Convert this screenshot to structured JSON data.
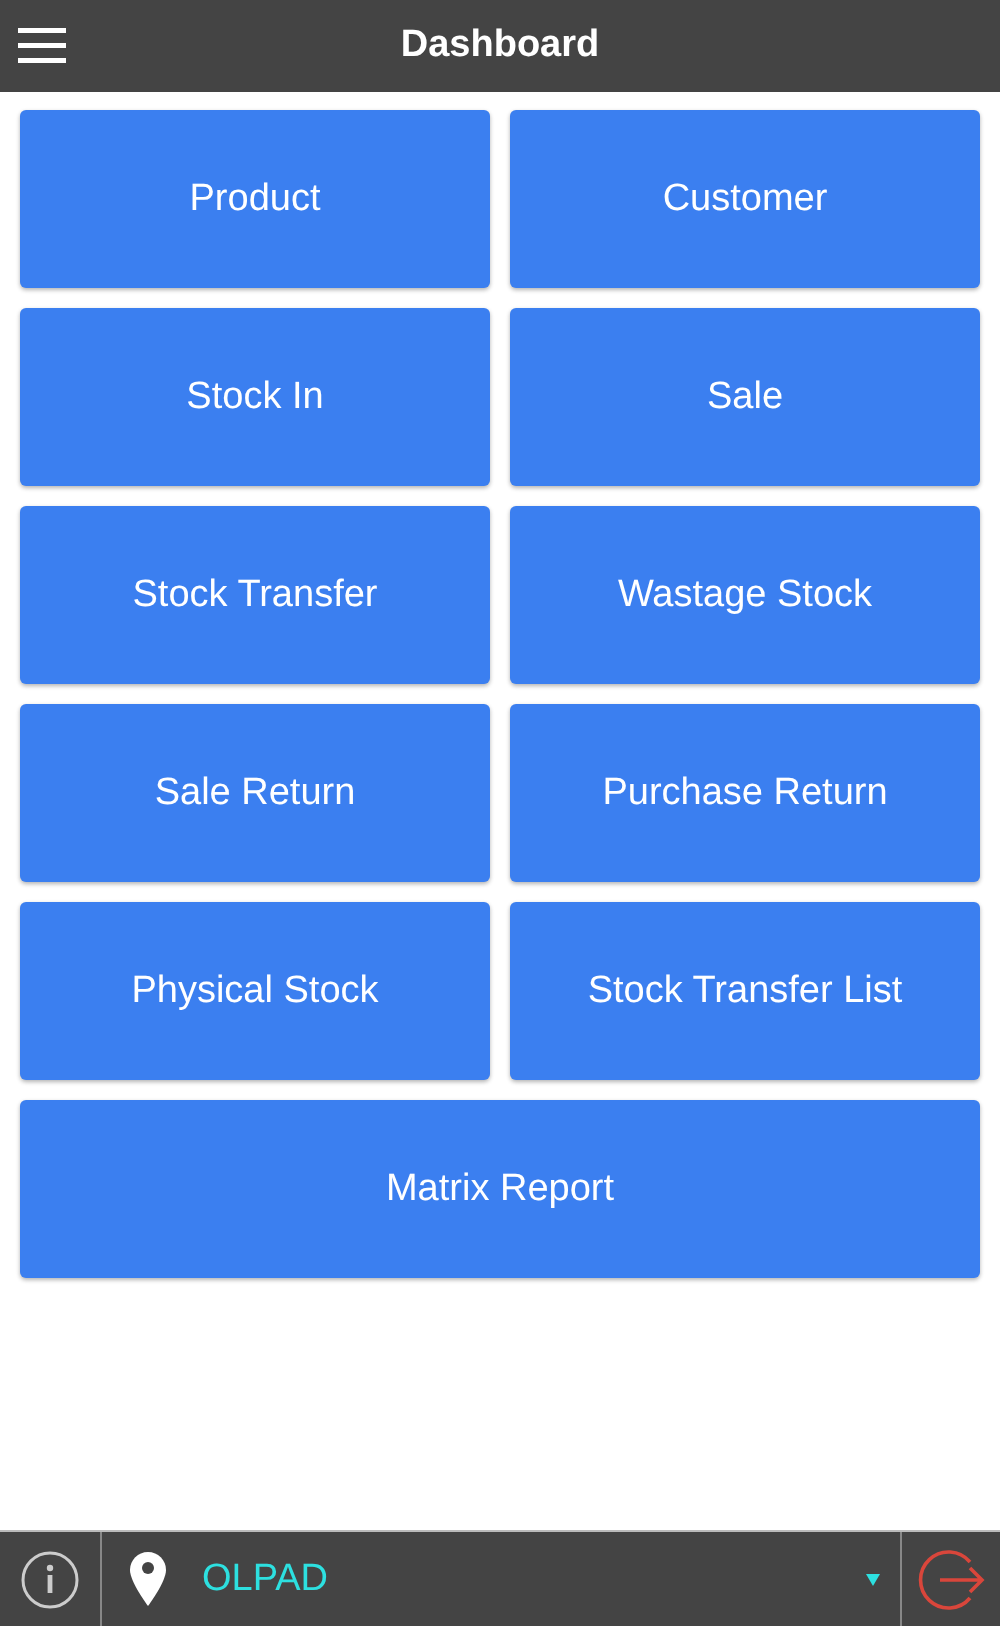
{
  "header": {
    "title": "Dashboard"
  },
  "tiles": [
    {
      "label": "Product",
      "wide": false
    },
    {
      "label": "Customer",
      "wide": false
    },
    {
      "label": "Stock In",
      "wide": false
    },
    {
      "label": "Sale",
      "wide": false
    },
    {
      "label": "Stock Transfer",
      "wide": false
    },
    {
      "label": "Wastage Stock",
      "wide": false
    },
    {
      "label": "Sale Return",
      "wide": false
    },
    {
      "label": "Purchase Return",
      "wide": false
    },
    {
      "label": "Physical Stock",
      "wide": false
    },
    {
      "label": "Stock Transfer List",
      "wide": false
    },
    {
      "label": "Matrix Report",
      "wide": true
    }
  ],
  "footer": {
    "location": "OLPAD"
  }
}
